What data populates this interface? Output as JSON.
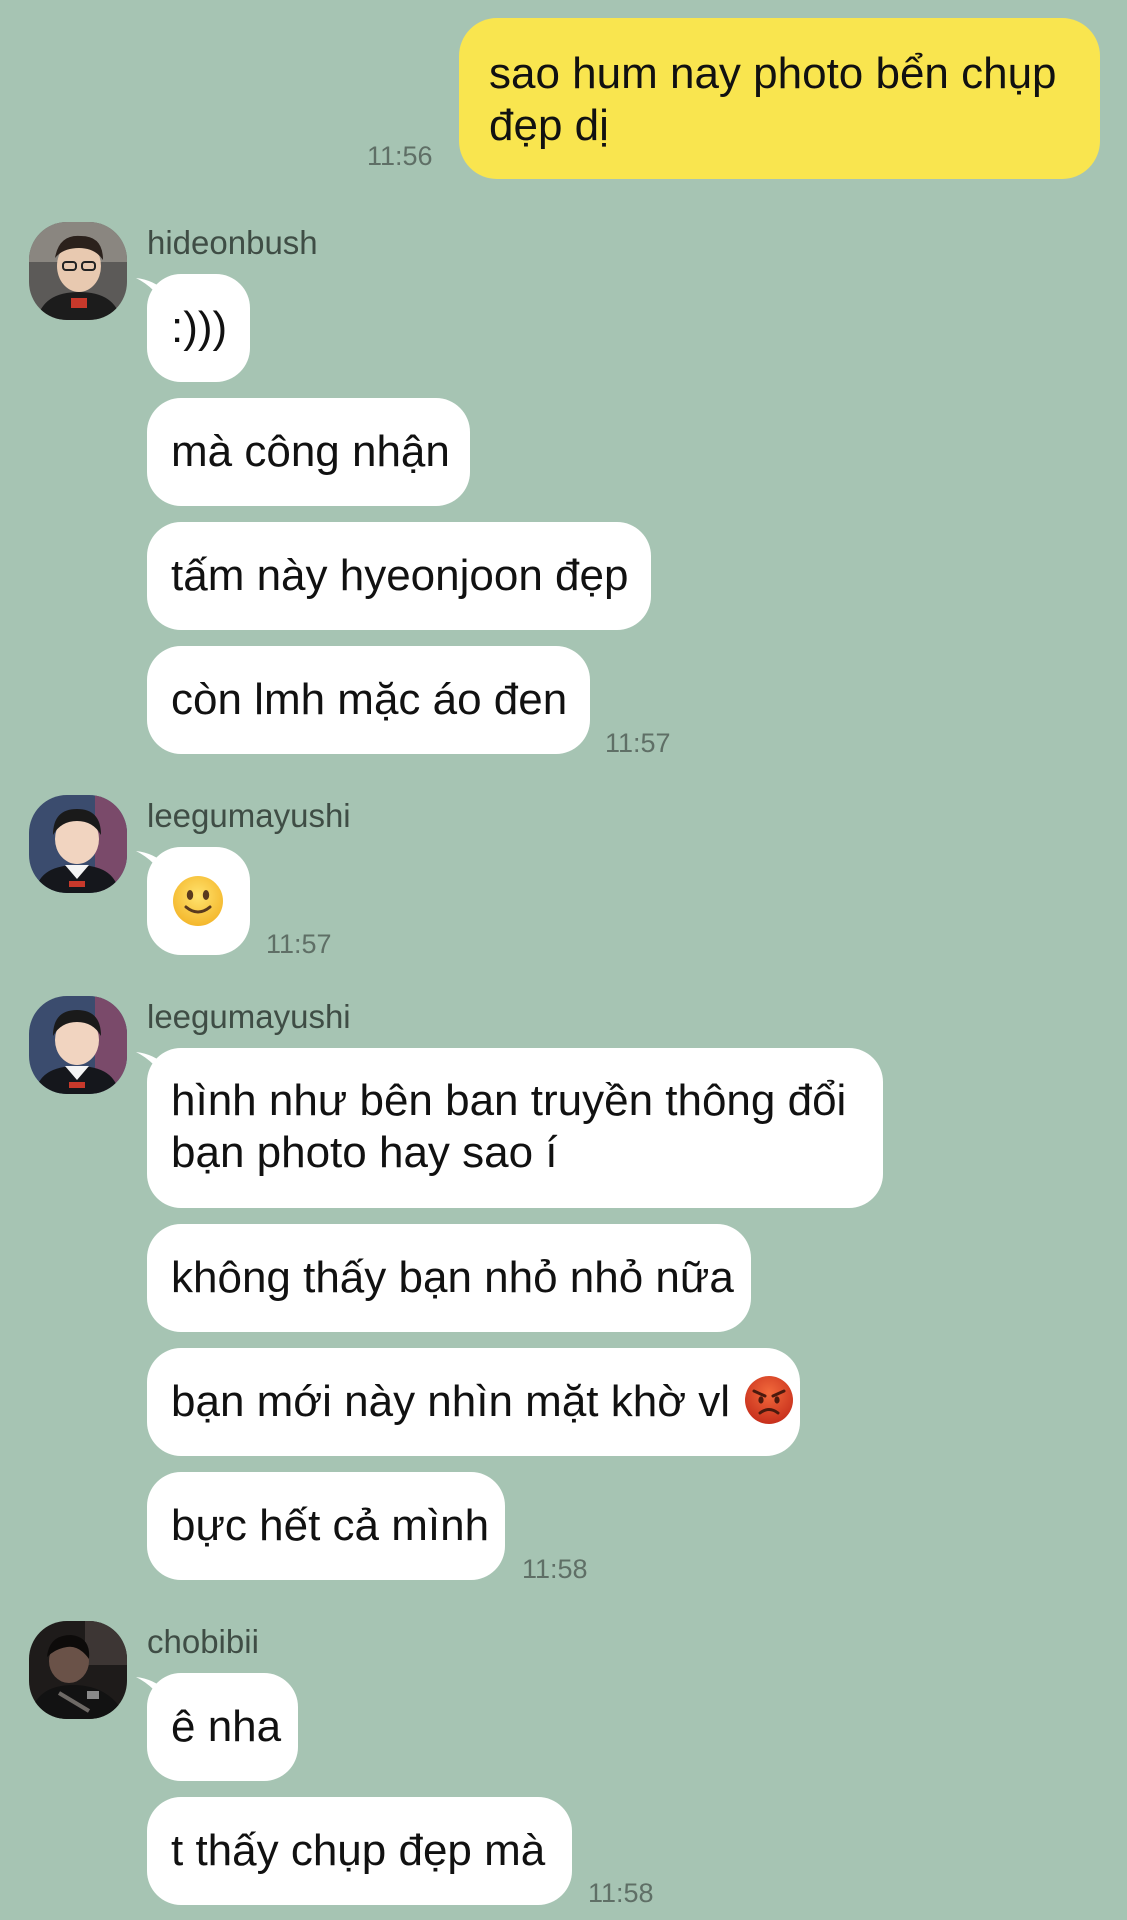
{
  "outgoing": [
    {
      "lines": [
        "sao hum nay photo bển chụp",
        "đẹp dị"
      ],
      "time": "11:56"
    }
  ],
  "groups": [
    {
      "sender": "hideonbush",
      "avatar": "hideonbush-avatar",
      "messages": [
        ":)))",
        "mà công nhận",
        "tấm này hyeonjoon đẹp",
        "còn lmh mặc áo đen"
      ],
      "time": "11:57"
    },
    {
      "sender": "leegumayushi",
      "avatar": "leegumayushi-avatar",
      "messages": [
        "slightly-smiling-face-emoji"
      ],
      "time": "11:57"
    },
    {
      "sender": "leegumayushi",
      "avatar": "leegumayushi-avatar",
      "messages": [
        [
          "hình như bên ban truyền thông đổi",
          "bạn photo hay sao í"
        ],
        "không thấy bạn nhỏ nhỏ nữa",
        "bạn mới này nhìn mặt khờ vl",
        "bực hết cả mình"
      ],
      "angry_emoji": "angry-face-emoji",
      "time": "11:58"
    },
    {
      "sender": "chobibii",
      "avatar": "chobibii-avatar",
      "messages": [
        "ê nha",
        "t thấy chụp đẹp mà"
      ],
      "time": "11:58"
    }
  ],
  "colors": {
    "background": "#a6c4b3",
    "incoming_bubble": "#ffffff",
    "outgoing_bubble": "#f9e54f"
  }
}
